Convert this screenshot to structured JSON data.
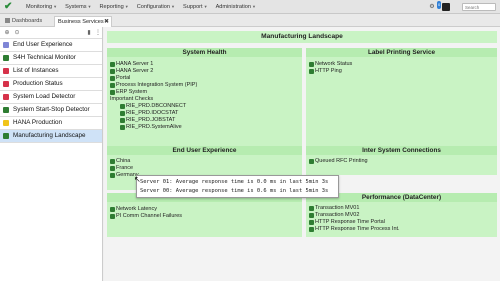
{
  "colors": {
    "panel_bg": "#c9f3c4",
    "status_green": "#2e7d32",
    "active_item": "#cfe2f7",
    "sidebar_colors": [
      "#7f86d6",
      "#2e7d32",
      "#d6324a",
      "#d6324a",
      "#d6324a",
      "#2e7d32",
      "#f0c419",
      "#2e7d32"
    ]
  },
  "topbar": {
    "logo_icon": "check-logo",
    "menus": [
      "Monitoring",
      "Systems",
      "Reporting",
      "Configuration",
      "Support",
      "Administration"
    ],
    "notification_count": "0",
    "search_placeholder": "Search"
  },
  "tabs": [
    {
      "label": "Dashboards"
    },
    {
      "label": "Business Services"
    }
  ],
  "sidebar": {
    "items": [
      {
        "label": "End User Experience"
      },
      {
        "label": "S4H Technical Monitor"
      },
      {
        "label": "List of Instances"
      },
      {
        "label": "Production Status"
      },
      {
        "label": "System Load Detector"
      },
      {
        "label": "System Start-Stop Detector"
      },
      {
        "label": "HANA Production"
      },
      {
        "label": "Manufacturing Landscape"
      }
    ]
  },
  "dashboard": {
    "title": "Manufacturing Landscape",
    "system_health": {
      "title": "System Health",
      "items": [
        "HANA Server 1",
        "HANA Server 2",
        "Portal",
        "Process Integration System (PIP)",
        "ERP System"
      ],
      "checks_label": "Important Checks",
      "checks": [
        "RIE_PRD.DBCONNECT",
        "RIE_PRD.IDOCSTAT",
        "RIE_PRD.JOBSTAT",
        "RIE_PRD.SystemAlive"
      ]
    },
    "label_printing": {
      "title": "Label Printing Service",
      "items": [
        "Network Status",
        "HTTP Ping"
      ]
    },
    "end_user": {
      "title": "End User Experience",
      "items": [
        "China",
        "France",
        "Germany"
      ]
    },
    "inter_system": {
      "title": "Inter System Connections",
      "items": [
        "Queued RFC Printing"
      ]
    },
    "network": {
      "items": [
        "Network Latency",
        "PI Comm Channel Failures"
      ]
    },
    "performance": {
      "title": "Performance (DataCenter)",
      "items": [
        "Transaction MV01",
        "Transaction MV02",
        "HTTP Response Time Portal",
        "HTTP Response Time Process Int."
      ]
    }
  },
  "tooltip": {
    "lines": [
      "Server 01: Average response time is 0.0 ms in last 5min 3s",
      "Server 00: Average response time is 0.6 ms in last 5min 3s"
    ]
  }
}
